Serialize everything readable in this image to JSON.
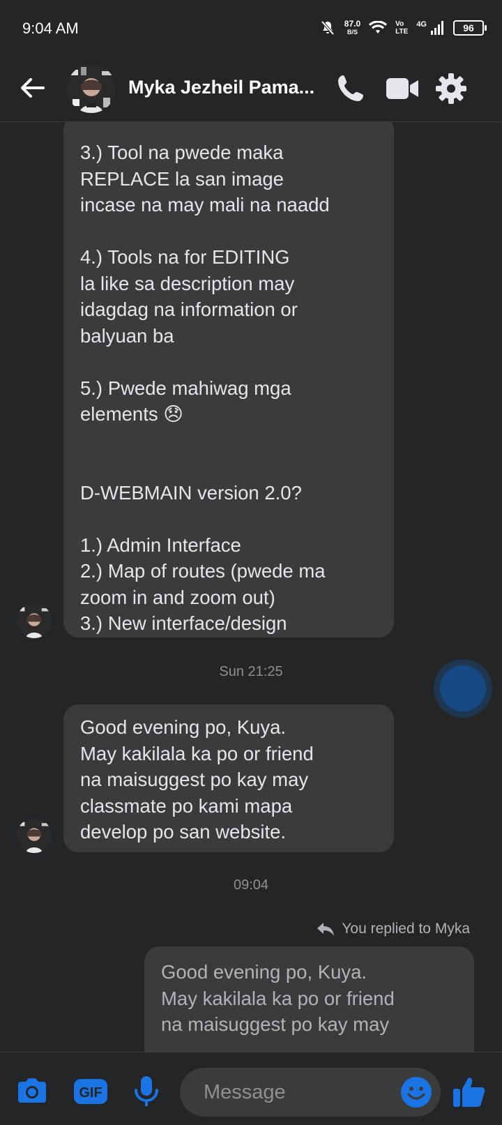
{
  "status_bar": {
    "time": "9:04 AM",
    "net_speed": "87.0",
    "net_unit": "B/S",
    "volte_top": "Vo",
    "volte_bottom": "LTE",
    "network": "4G",
    "battery": "96"
  },
  "header": {
    "contact_name": "Myka Jezheil Pama..."
  },
  "messages": [
    {
      "direction": "incoming",
      "text": "3.) Tool na pwede maka\nREPLACE la san image\nincase na may mali na naadd\n\n4.) Tools na for EDITING\nla like sa description may\nidagdag na information or\nbalyuan ba\n\n5.) Pwede mahiwag mga\nelements 😞\n\n\nD-WEBMAIN version 2.0?\n\n1.) Admin Interface\n2.) Map of routes (pwede ma\nzoom in and zoom out)\n3.) New interface/design"
    },
    {
      "type": "timestamp",
      "text": "Sun 21:25"
    },
    {
      "direction": "incoming",
      "text": "Good evening po, Kuya.\nMay kakilala ka po or friend\nna maisuggest po kay may\nclassmate po kami mapa\ndevelop po san website."
    },
    {
      "type": "timestamp",
      "text": "09:04"
    },
    {
      "type": "reply_note",
      "text": "You replied to Myka"
    },
    {
      "direction": "outgoing_quote",
      "text": "Good evening po, Kuya.\nMay kakilala ka po or friend\nna maisuggest po kay may"
    }
  ],
  "composer": {
    "placeholder": "Message"
  },
  "colors": {
    "background": "#242526",
    "bubble": "#3a3b3c",
    "accent": "#1b74e4"
  },
  "icons": {
    "back": "arrow-left-icon",
    "call": "phone-icon",
    "video": "video-camera-icon",
    "settings": "gear-icon",
    "camera": "camera-icon",
    "gif": "gif-icon",
    "mic": "microphone-icon",
    "emoji": "smiley-icon",
    "like": "thumbs-up-icon",
    "reply": "reply-arrow-icon"
  }
}
